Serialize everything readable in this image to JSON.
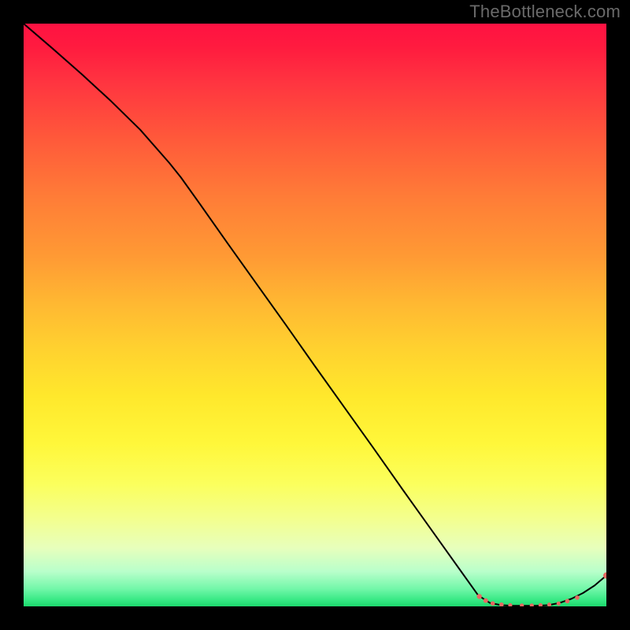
{
  "attribution": "TheBottleneck.com",
  "chart_data": {
    "type": "line",
    "title": "",
    "xlabel": "",
    "ylabel": "",
    "xlim": [
      0,
      100
    ],
    "ylim": [
      0,
      100
    ],
    "series": [
      {
        "name": "curve",
        "x": [
          0,
          5,
          10,
          15,
          20,
          25,
          27,
          30,
          35,
          40,
          45,
          50,
          55,
          60,
          65,
          70,
          75,
          78,
          80,
          82,
          84,
          86,
          88,
          90,
          92,
          94,
          96,
          98,
          100
        ],
        "y": [
          100,
          95.7,
          91.3,
          86.7,
          81.8,
          76.1,
          73.6,
          69.4,
          62.3,
          55.3,
          48.3,
          41.2,
          34.2,
          27.2,
          20.1,
          13.1,
          6.1,
          1.9,
          0.6,
          0.2,
          0.1,
          0.1,
          0.1,
          0.2,
          0.6,
          1.3,
          2.3,
          3.6,
          5.3
        ]
      },
      {
        "name": "markers",
        "points": [
          {
            "x": 78.2,
            "y": 1.7,
            "r": 3.2
          },
          {
            "x": 79.3,
            "y": 1.0,
            "r": 3.0
          },
          {
            "x": 80.5,
            "y": 0.5,
            "r": 2.8
          },
          {
            "x": 82.0,
            "y": 0.3,
            "r": 2.8
          },
          {
            "x": 83.5,
            "y": 0.2,
            "r": 2.6
          },
          {
            "x": 85.5,
            "y": 0.15,
            "r": 2.6
          },
          {
            "x": 87.2,
            "y": 0.15,
            "r": 2.6
          },
          {
            "x": 88.7,
            "y": 0.2,
            "r": 2.6
          },
          {
            "x": 90.2,
            "y": 0.3,
            "r": 2.6
          },
          {
            "x": 91.8,
            "y": 0.5,
            "r": 2.6
          },
          {
            "x": 93.3,
            "y": 0.9,
            "r": 2.8
          },
          {
            "x": 95.0,
            "y": 1.5,
            "r": 2.8
          },
          {
            "x": 100.0,
            "y": 5.3,
            "r": 4.0
          }
        ]
      }
    ],
    "colors": {
      "line": "#000000",
      "marker": "#e66a63"
    }
  }
}
